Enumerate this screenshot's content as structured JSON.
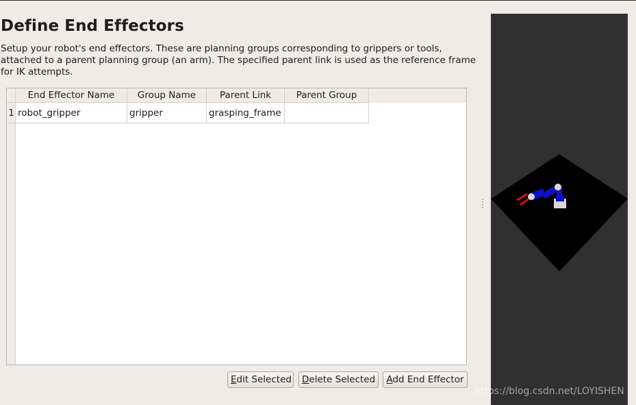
{
  "page": {
    "title": "Define End Effectors",
    "description": "Setup your robot's end effectors. These are planning groups corresponding to grippers or tools, attached to a parent planning group (an arm). The specified parent link is used as the reference frame for IK attempts."
  },
  "table": {
    "columns": [
      "End Effector Name",
      "Group Name",
      "Parent Link",
      "Parent Group"
    ],
    "rows": [
      {
        "index": "1",
        "end_effector_name": "robot_gripper",
        "group_name": "gripper",
        "parent_link": "grasping_frame",
        "parent_group": ""
      }
    ]
  },
  "buttons": {
    "edit": {
      "mnemonic": "E",
      "rest": "dit Selected"
    },
    "delete": {
      "mnemonic": "D",
      "rest": "elete Selected"
    },
    "add": {
      "mnemonic": "A",
      "rest": "dd End Effector"
    }
  },
  "viewport": {
    "background": "#303030",
    "ground_color": "#000000",
    "arm_color": "#1010c8",
    "joint_color": "#d8d8d8",
    "gripper_color": "#cc1010"
  },
  "watermark": "https://blog.csdn.net/LOYISHEN"
}
